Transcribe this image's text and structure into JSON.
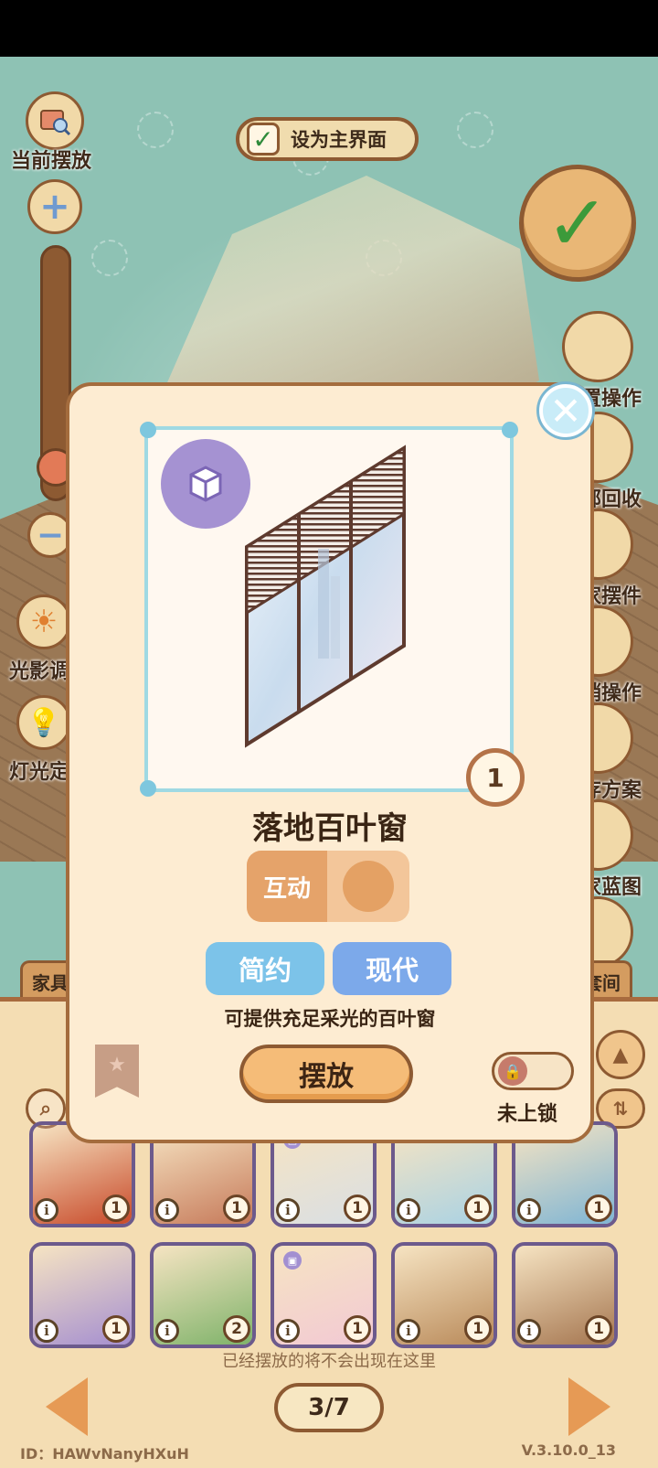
{
  "top": {
    "set_main_label": "设为主界面"
  },
  "left_controls": {
    "current_layout_label": "当前摆放",
    "lighting_label": "光影调",
    "lamp_label": "灯光定"
  },
  "right_controls": [
    {
      "label": "置操作"
    },
    {
      "label": "部回收"
    },
    {
      "label": "家摆件"
    },
    {
      "label": "销操作"
    },
    {
      "label": "存方案"
    },
    {
      "label": "家蓝图"
    }
  ],
  "tabs": {
    "left": "家具",
    "right": "套间"
  },
  "modal": {
    "item_name": "落地百叶窗",
    "quantity": "1",
    "interact_label": "互动",
    "tags": [
      "简约",
      "现代"
    ],
    "description": "可提供充足采光的百叶窗",
    "place_label": "摆放",
    "lock_label": "未上锁",
    "close_symbol": "✕"
  },
  "inventory": {
    "items": [
      {
        "count": "1",
        "badge": false,
        "bg": "#c84a2a"
      },
      {
        "count": "1",
        "badge": false,
        "bg": "#c67a5a"
      },
      {
        "count": "1",
        "badge": true,
        "bg": "#d9dfe4"
      },
      {
        "count": "1",
        "badge": false,
        "bg": "#a9d2e4"
      },
      {
        "count": "1",
        "badge": false,
        "bg": "#7fb5d4"
      },
      {
        "count": "1",
        "badge": false,
        "bg": "#a58fd0"
      },
      {
        "count": "2",
        "badge": false,
        "bg": "#7fb36a"
      },
      {
        "count": "1",
        "badge": true,
        "bg": "#f2c9d4"
      },
      {
        "count": "1",
        "badge": false,
        "bg": "#b98a5a"
      },
      {
        "count": "1",
        "badge": false,
        "bg": "#a57650"
      }
    ],
    "info_symbol": "i",
    "hint": "已经摆放的将不会出现在这里"
  },
  "pager": {
    "text": "3/7"
  },
  "footer": {
    "id": "ID：HAWvNanyHXuH",
    "version": "V.3.10.0_13"
  }
}
